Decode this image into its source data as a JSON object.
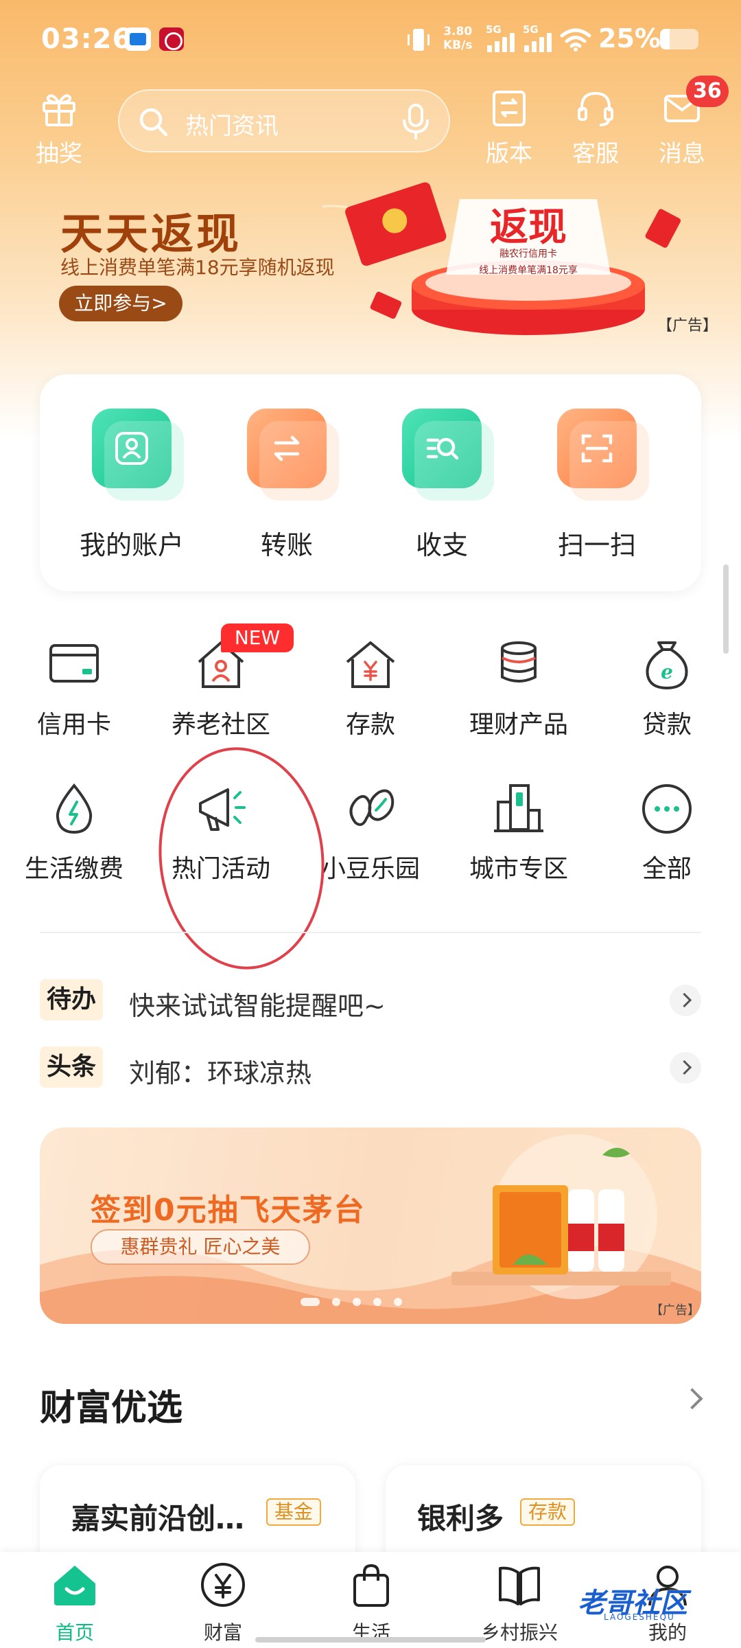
{
  "status_bar": {
    "time": "03:26",
    "net_speed_value": "3.80",
    "net_speed_unit": "KB/s",
    "sim1_label": "5G",
    "sim2_label": "5G",
    "battery_pct": "25%",
    "battery_level": 0.25
  },
  "header": {
    "lottery_label": "抽奖",
    "search_placeholder": "热门资讯",
    "version_label": "版本",
    "service_label": "客服",
    "messages_label": "消息",
    "messages_badge": "36"
  },
  "banner": {
    "title": "天天返现",
    "subtitle": "线上消费单笔满18元享随机返现",
    "button": "立即参与>",
    "ad_tag": "【广告】",
    "art_heading": "返现",
    "art_brand": "融农行信用卡",
    "art_caption": "线上消费单笔满18元享"
  },
  "quick_actions": [
    {
      "label": "我的账户",
      "icon": "account-icon",
      "color": "green"
    },
    {
      "label": "转账",
      "icon": "transfer-icon",
      "color": "orange"
    },
    {
      "label": "收支",
      "icon": "income-expense-icon",
      "color": "green"
    },
    {
      "label": "扫一扫",
      "icon": "scan-icon",
      "color": "orange"
    }
  ],
  "grid": {
    "row1": [
      {
        "label": "信用卡",
        "icon": "credit-card-icon"
      },
      {
        "label": "养老社区",
        "icon": "elderly-community-icon",
        "badge": "NEW"
      },
      {
        "label": "存款",
        "icon": "deposit-icon"
      },
      {
        "label": "理财产品",
        "icon": "wealth-product-icon"
      },
      {
        "label": "贷款",
        "icon": "loan-icon"
      }
    ],
    "row2": [
      {
        "label": "生活缴费",
        "icon": "utility-payment-icon"
      },
      {
        "label": "热门活动",
        "icon": "megaphone-icon"
      },
      {
        "label": "小豆乐园",
        "icon": "bean-park-icon"
      },
      {
        "label": "城市专区",
        "icon": "city-zone-icon"
      },
      {
        "label": "全部",
        "icon": "more-icon"
      }
    ]
  },
  "notices": [
    {
      "tag": "待办",
      "text": "快来试试智能提醒吧~"
    },
    {
      "tag": "头条",
      "text": "刘郁：环球凉热"
    }
  ],
  "promo": {
    "title": "签到0元抽飞天茅台",
    "pill": "惠群贵礼 匠心之美",
    "ad_tag": "【广告】"
  },
  "wealth": {
    "title": "财富优选",
    "cards": [
      {
        "name": "嘉实前沿创…",
        "tag": "基金"
      },
      {
        "name": "银利多",
        "tag": "存款"
      }
    ]
  },
  "tabbar": [
    {
      "label": "首页",
      "icon": "home-icon",
      "active": true
    },
    {
      "label": "财富",
      "icon": "yuan-icon"
    },
    {
      "label": "生活",
      "icon": "shopping-bag-icon"
    },
    {
      "label": "乡村振兴",
      "icon": "book-icon"
    },
    {
      "label": "我的",
      "icon": "profile-icon"
    }
  ],
  "watermark": "老哥社区",
  "watermark_sub": "LAOGESHEQU",
  "colors": {
    "accent_green": "#0fb987",
    "header_orange": "#f9b96a",
    "badge_red": "#f03b3b",
    "annotation_red": "#e0404a"
  }
}
